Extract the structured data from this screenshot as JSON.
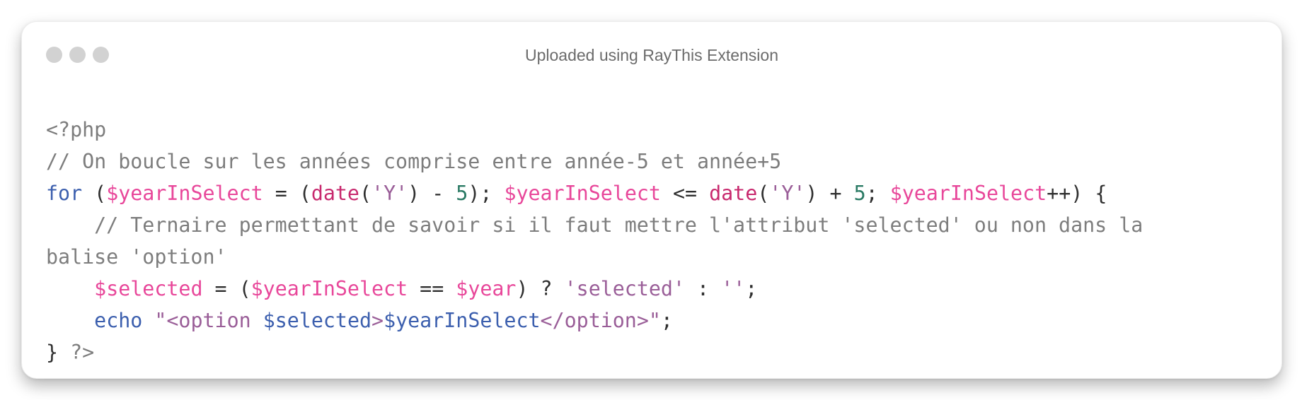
{
  "window": {
    "title": "Uploaded using RayThis Extension",
    "controls": [
      "close-dot",
      "minimize-dot",
      "maximize-dot"
    ]
  },
  "colors": {
    "default": "#2f2f2f",
    "comment": "#7d7d7d",
    "keyword": "#3c5fae",
    "variable": "#e8479a",
    "function": "#c8296e",
    "string": "#9a5e98",
    "number": "#2a7a64"
  },
  "code": {
    "language": "php",
    "lines": [
      [
        {
          "t": "meta",
          "v": "<?php"
        }
      ],
      [
        {
          "t": "comment",
          "v": "// On boucle sur les années comprise entre année-5 et année+5"
        }
      ],
      [
        {
          "t": "keyword",
          "v": "for"
        },
        {
          "t": "default",
          "v": " ("
        },
        {
          "t": "variable",
          "v": "$yearInSelect"
        },
        {
          "t": "default",
          "v": " = ("
        },
        {
          "t": "function",
          "v": "date"
        },
        {
          "t": "default",
          "v": "("
        },
        {
          "t": "string",
          "v": "'Y'"
        },
        {
          "t": "default",
          "v": ") - "
        },
        {
          "t": "number",
          "v": "5"
        },
        {
          "t": "default",
          "v": "); "
        },
        {
          "t": "variable",
          "v": "$yearInSelect"
        },
        {
          "t": "default",
          "v": " <= "
        },
        {
          "t": "function",
          "v": "date"
        },
        {
          "t": "default",
          "v": "("
        },
        {
          "t": "string",
          "v": "'Y'"
        },
        {
          "t": "default",
          "v": ") + "
        },
        {
          "t": "number",
          "v": "5"
        },
        {
          "t": "default",
          "v": "; "
        },
        {
          "t": "variable",
          "v": "$yearInSelect"
        },
        {
          "t": "default",
          "v": "++) {"
        }
      ],
      [
        {
          "t": "comment",
          "v": "    // Ternaire permettant de savoir si il faut mettre l'attribut 'selected' ou non dans la"
        }
      ],
      [
        {
          "t": "comment",
          "v": "balise 'option'"
        }
      ],
      [
        {
          "t": "default",
          "v": "    "
        },
        {
          "t": "variable",
          "v": "$selected"
        },
        {
          "t": "default",
          "v": " = ("
        },
        {
          "t": "variable",
          "v": "$yearInSelect"
        },
        {
          "t": "default",
          "v": " == "
        },
        {
          "t": "variable",
          "v": "$year"
        },
        {
          "t": "default",
          "v": ") ? "
        },
        {
          "t": "string",
          "v": "'selected'"
        },
        {
          "t": "default",
          "v": " : "
        },
        {
          "t": "string",
          "v": "''"
        },
        {
          "t": "default",
          "v": ";"
        }
      ],
      [
        {
          "t": "default",
          "v": "    "
        },
        {
          "t": "keyword",
          "v": "echo"
        },
        {
          "t": "default",
          "v": " "
        },
        {
          "t": "string",
          "v": "\"<option "
        },
        {
          "t": "keyword",
          "v": "$selected"
        },
        {
          "t": "string",
          "v": ">"
        },
        {
          "t": "keyword",
          "v": "$yearInSelect"
        },
        {
          "t": "string",
          "v": "</option>\""
        },
        {
          "t": "default",
          "v": ";"
        }
      ],
      [
        {
          "t": "default",
          "v": "} "
        },
        {
          "t": "meta",
          "v": "?>"
        }
      ]
    ]
  }
}
